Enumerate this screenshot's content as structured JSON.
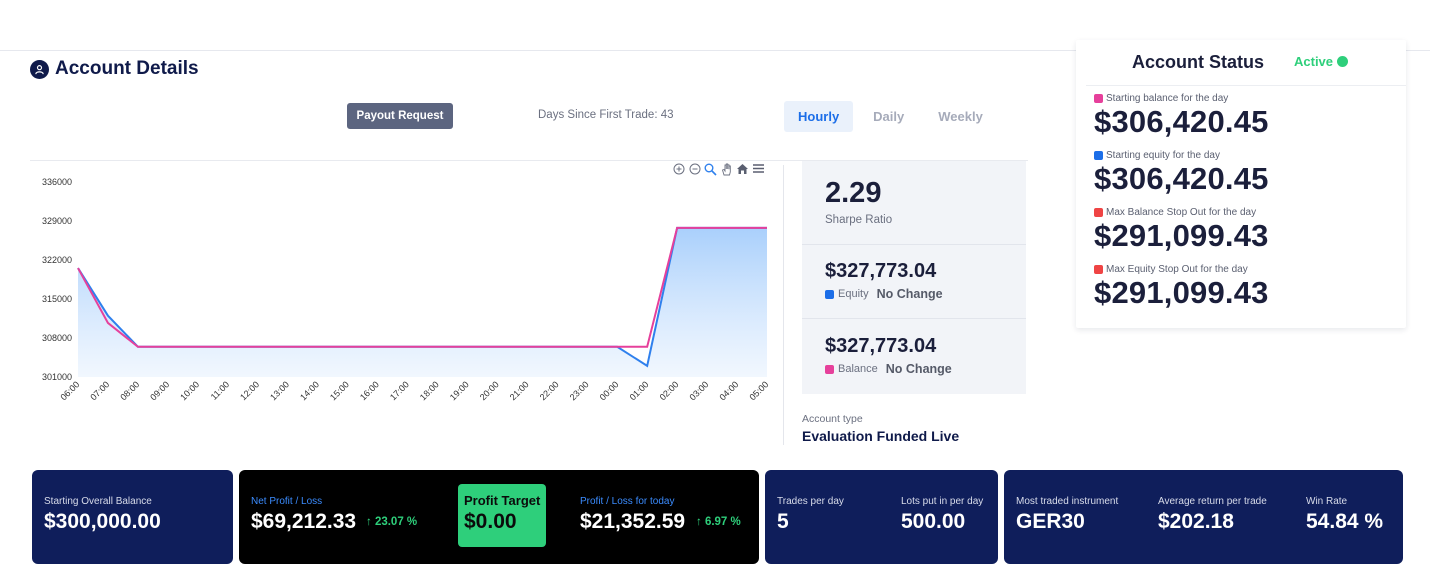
{
  "header": {
    "title": "Account Details",
    "payout_button": "Payout Request",
    "days_since": "Days Since First Trade: 43",
    "tabs": [
      {
        "label": "Hourly",
        "active": true
      },
      {
        "label": "Daily",
        "active": false
      },
      {
        "label": "Weekly",
        "active": false
      }
    ]
  },
  "chart_data": {
    "type": "area",
    "x": [
      "06:00",
      "07:00",
      "08:00",
      "09:00",
      "10:00",
      "11:00",
      "12:00",
      "13:00",
      "14:00",
      "15:00",
      "16:00",
      "17:00",
      "18:00",
      "19:00",
      "20:00",
      "21:00",
      "22:00",
      "23:00",
      "00:00",
      "01:00",
      "02:00",
      "03:00",
      "04:00",
      "05:00"
    ],
    "y_ticks": [
      "336000",
      "329000",
      "322000",
      "315000",
      "308000",
      "301000"
    ],
    "ylim": [
      301000,
      336000
    ],
    "series": [
      {
        "color": "#2f80ed",
        "values": [
          320550,
          312000,
          306420,
          306420,
          306420,
          306420,
          306420,
          306420,
          306420,
          306420,
          306420,
          306420,
          306420,
          306420,
          306420,
          306420,
          306420,
          306420,
          306420,
          303000,
          327773,
          327773,
          327773,
          327773
        ]
      },
      {
        "color": "#e6409b",
        "values": [
          320550,
          310700,
          306420,
          306420,
          306420,
          306420,
          306420,
          306420,
          306420,
          306420,
          306420,
          306420,
          306420,
          306420,
          306420,
          306420,
          306420,
          306420,
          306420,
          306420,
          327773,
          327773,
          327773,
          327773
        ]
      }
    ],
    "toolbar_icons": [
      "zoom-in-icon",
      "zoom-out-icon",
      "magnifier-icon",
      "pan-hand-icon",
      "home-icon",
      "menu-icon"
    ]
  },
  "metrics": {
    "sharpe_value": "2.29",
    "sharpe_label": "Sharpe Ratio",
    "equity_value": "$327,773.04",
    "equity_label": "Equity",
    "equity_change": "No Change",
    "equity_color": "#1c6ee8",
    "balance_value": "$327,773.04",
    "balance_label": "Balance",
    "balance_change": "No Change",
    "balance_color": "#e6409b",
    "account_type_label": "Account type",
    "account_type_value": "Evaluation Funded Live"
  },
  "status": {
    "title": "Account Status",
    "state": "Active",
    "items": [
      {
        "label": "Starting balance for the day",
        "value": "$306,420.45",
        "color": "#e6409b"
      },
      {
        "label": "Starting equity for the day",
        "value": "$306,420.45",
        "color": "#1c6ee8"
      },
      {
        "label": "Max Balance Stop Out for the day",
        "value": "$291,099.43",
        "color": "#ef4444"
      },
      {
        "label": "Max Equity Stop Out for the day",
        "value": "$291,099.43",
        "color": "#ef4444"
      }
    ]
  },
  "cards": {
    "starting_overall_label": "Starting Overall Balance",
    "starting_overall_value": "$300,000.00",
    "net_pl_label": "Net Profit / Loss",
    "net_pl_value": "$69,212.33",
    "net_pl_pct": "↑ 23.07 %",
    "profit_target_label": "Profit Target",
    "profit_target_value": "$0.00",
    "pl_today_label": "Profit / Loss for today",
    "pl_today_value": "$21,352.59",
    "pl_today_pct": "↑ 6.97 %",
    "trades_label": "Trades per day",
    "trades_value": "5",
    "lots_label": "Lots put in per day",
    "lots_value": "500.00",
    "instrument_label": "Most traded instrument",
    "instrument_value": "GER30",
    "avg_return_label": "Average return per trade",
    "avg_return_value": "$202.18",
    "winrate_label": "Win Rate",
    "winrate_value": "54.84 %"
  }
}
